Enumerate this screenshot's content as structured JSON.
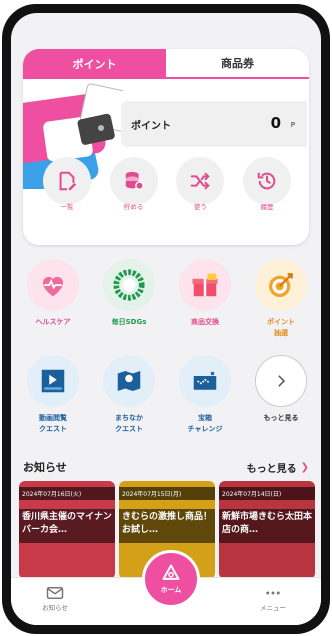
{
  "point_card": {
    "tabs": [
      {
        "label": "ポイント",
        "active": true
      },
      {
        "label": "商品券",
        "active": false
      }
    ],
    "balance_label": "ポイント",
    "balance_value": "0",
    "balance_unit": "P",
    "actions": [
      {
        "label": "一覧",
        "icon": "document-edit-icon"
      },
      {
        "label": "貯める",
        "icon": "coin-stack-icon"
      },
      {
        "label": "使う",
        "icon": "shuffle-icon"
      },
      {
        "label": "履歴",
        "icon": "history-clock-icon"
      }
    ]
  },
  "services": [
    {
      "label": "ヘルスケア",
      "icon": "heart-pulse-icon",
      "bg": "#fde3ec",
      "color": "#e04d8f"
    },
    {
      "label": "毎日SDGs",
      "icon": "sdgs-wheel-icon",
      "bg": "#e3f3ea",
      "color": "#1f9a4e"
    },
    {
      "label": "商品交換",
      "icon": "gift-box-icon",
      "bg": "#fde3ec",
      "color": "#e04d8f"
    },
    {
      "label": "ポイント\n抽選",
      "icon": "target-icon",
      "bg": "#fff1d8",
      "color": "#e08a1a"
    },
    {
      "label": "動画閲覧\nクエスト",
      "icon": "video-ad-icon",
      "bg": "#e2eef8",
      "color": "#1d5f9a"
    },
    {
      "label": "まちなか\nクエスト",
      "icon": "map-pin-icon",
      "bg": "#e2eef8",
      "color": "#1d5f9a"
    },
    {
      "label": "宝箱\nチャレンジ",
      "icon": "treasure-map-icon",
      "bg": "#e2eef8",
      "color": "#1d5f9a"
    },
    {
      "label": "もっと見る",
      "icon": "chevron-right-icon",
      "bg": "#ffffff",
      "color": "#333333"
    }
  ],
  "news": {
    "title": "お知らせ",
    "more_label": "もっと見る",
    "items": [
      {
        "date": "2024年07月16日(火)",
        "text": "香川県主催のマイナンバーカ会…",
        "bg": "#c83a4a"
      },
      {
        "date": "2024年07月15日(月)",
        "text": "きむらの激推し商品！お試し…",
        "bg": "#d4a017"
      },
      {
        "date": "2024年07月14日(日)",
        "text": "新鮮市場きむら太田本店の商…",
        "bg": "#b8343f"
      }
    ]
  },
  "bottom_nav": {
    "notice_label": "お知らせ",
    "home_label": "ホーム",
    "menu_label": "メニュー"
  },
  "colors": {
    "accent": "#ef4fa0",
    "text_pink": "#e04d8f"
  }
}
